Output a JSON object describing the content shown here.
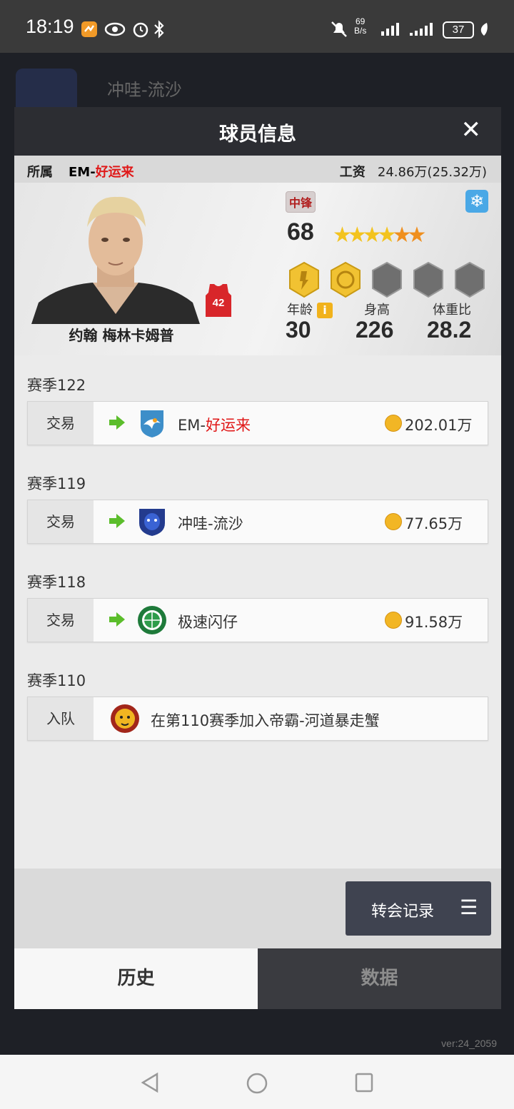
{
  "status_bar": {
    "time": "18:19",
    "net_speed_value": "69",
    "net_speed_unit": "B/s",
    "battery": "37",
    "icons": [
      "app-icon",
      "eye-icon",
      "alarm-icon",
      "bluetooth-icon",
      "mute-icon",
      "signal-icon",
      "signal-icon",
      "leaf-icon"
    ]
  },
  "background": {
    "team_name": "冲哇-流沙",
    "version": "ver:24_2059"
  },
  "modal": {
    "title": "球员信息",
    "close": "✕",
    "affiliation_label": "所属",
    "team_prefix": "EM-",
    "team_name": "好运来",
    "salary_label": "工资",
    "salary_value": "24.86万(25.32万)"
  },
  "player": {
    "name": "约翰 梅林卡姆普",
    "jersey_number": "42",
    "position": "中锋",
    "overall": "68",
    "stars_gold": 4,
    "stars_orange": 2,
    "age_label": "年龄",
    "age": "30",
    "height_label": "身高",
    "height": "226",
    "weight_label": "体重比",
    "weight": "28.2"
  },
  "history": [
    {
      "season": "赛季122",
      "type": "交易",
      "team_prefix": "EM-",
      "team_highlight": "好运来",
      "fee": "202.01万",
      "logo": "eagle-logo"
    },
    {
      "season": "赛季119",
      "type": "交易",
      "team_prefix": "冲哇-流沙",
      "team_highlight": "",
      "fee": "77.65万",
      "logo": "panther-logo"
    },
    {
      "season": "赛季118",
      "type": "交易",
      "team_prefix": "极速闪仔",
      "team_highlight": "",
      "fee": "91.58万",
      "logo": "basketball-logo"
    },
    {
      "season": "赛季110",
      "type": "入队",
      "text": "在第110赛季加入帝霸-河道暴走蟹",
      "logo": "lion-logo"
    }
  ],
  "footer": {
    "transfer_button": "转会记录",
    "menu_icon": "☰"
  },
  "tabs": {
    "history": "历史",
    "data": "数据"
  },
  "colors": {
    "header": "#2c2d32",
    "accent_red": "#e01818",
    "coin": "#f2b625",
    "arrow_green": "#5bbd2b"
  }
}
